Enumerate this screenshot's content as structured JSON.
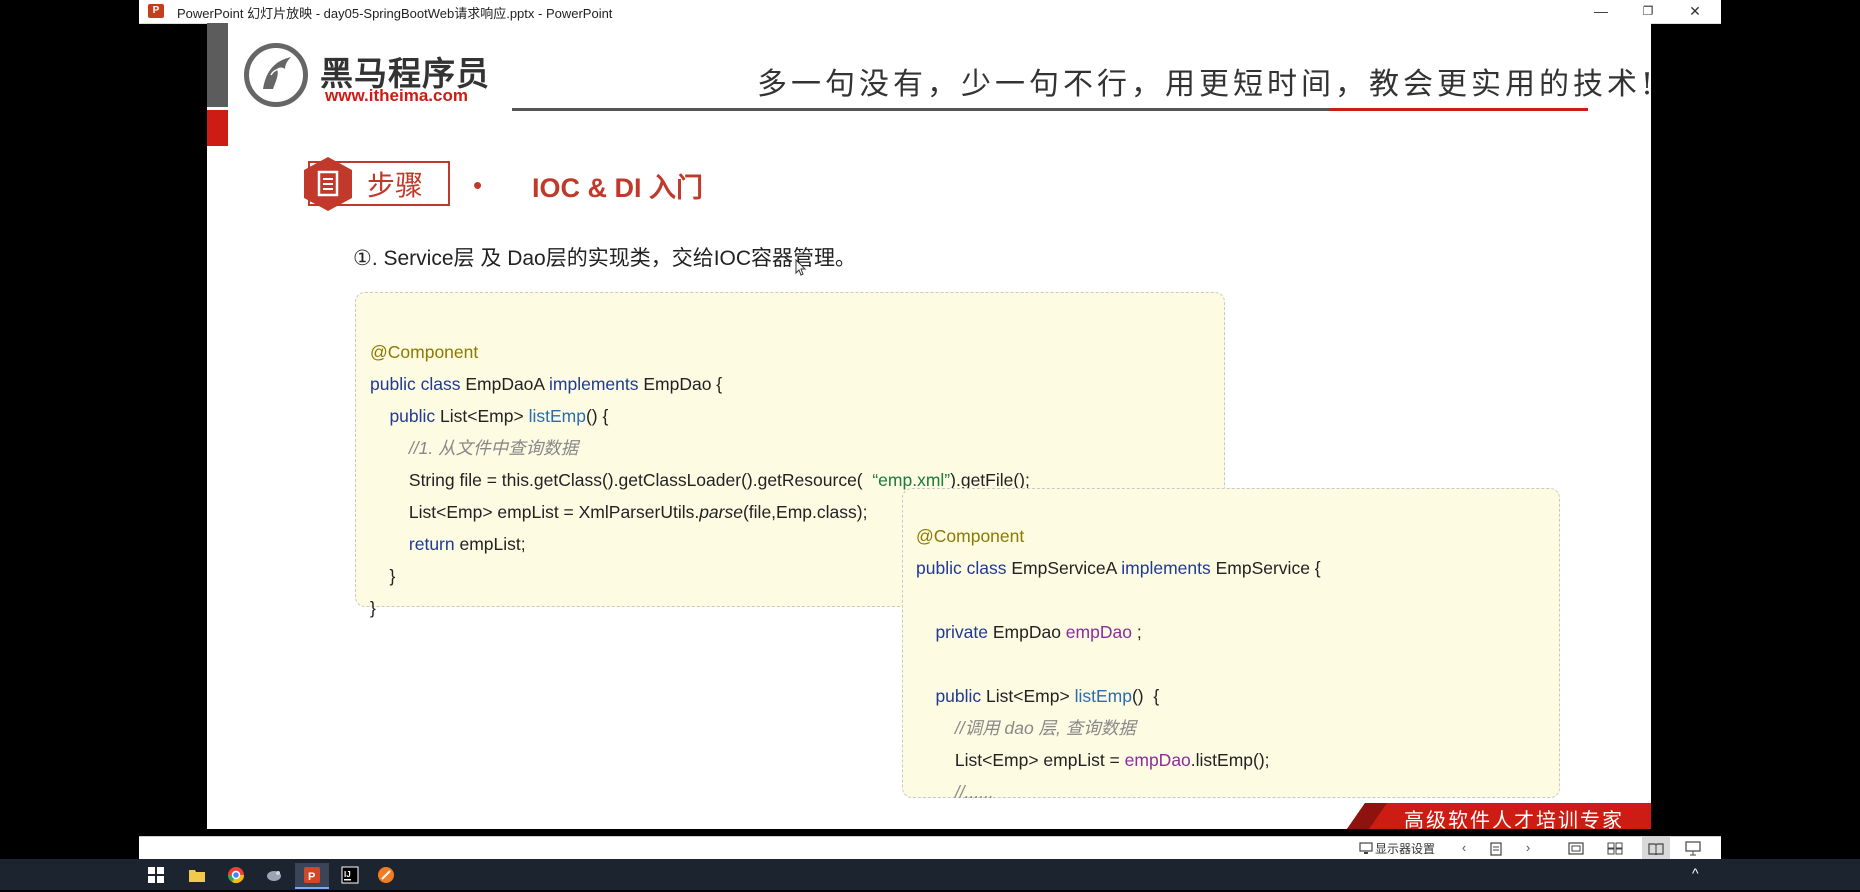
{
  "window": {
    "title": "PowerPoint 幻灯片放映  -  day05-SpringBootWeb请求响应.pptx - PowerPoint",
    "controls": {
      "minimize": "—",
      "restore": "❐",
      "close": "✕"
    }
  },
  "slide": {
    "logo": {
      "name_cn": "黑马程序员",
      "url": "www.itheima.com"
    },
    "slogan": "多一句没有，少一句不行，用更短时间，教会更实用的技术!",
    "step_label": "步骤",
    "step_bullet": "•",
    "section_title": "IOC & DI 入门",
    "step1_text": "①. Service层 及 Dao层的实现类，交给IOC容器管理。",
    "code_dao": {
      "l1": "@Component",
      "l2a": "public class",
      "l2b": " EmpDaoA ",
      "l2c": "implements",
      "l2d": " EmpDao {",
      "l3a": "    public",
      "l3b": " List<Emp> ",
      "l3c": "listEmp",
      "l3d": "() {",
      "l4": "        //1. 从文件中查询数据",
      "l5a": "        String file = this.getClass().getClassLoader().getResource(  ",
      "l5b": "“emp.xml”",
      "l5c": ").getFile();",
      "l6a": "        List<Emp> empList = XmlParserUtils.",
      "l6b": "parse",
      "l6c": "(file,Emp.class);",
      "l7a": "        return",
      "l7b": " empList;",
      "l8": "    }",
      "l9": "}"
    },
    "code_service": {
      "l1": "@Component",
      "l2a": "public class",
      "l2b": " EmpServiceA ",
      "l2c": "implements",
      "l2d": " EmpService {",
      "l4a": "    private",
      "l4b": " EmpDao ",
      "l4c": "empDao",
      "l4d": " ;",
      "l6a": "    public",
      "l6b": " List<Emp> ",
      "l6c": "listEmp",
      "l6d": "()  {",
      "l7": "        //调用 dao 层, 查询数据",
      "l8a": "        List<Emp> empList = ",
      "l8b": "empDao",
      "l8c": ".listEmp();",
      "l9": "        //......"
    },
    "footer_tag": "高级软件人才培训专家"
  },
  "statusbar": {
    "display_settings": "显示器设置"
  },
  "colors": {
    "brand_red": "#cc1c14",
    "code_bg": "#fefbe3",
    "keyword": "#1f3a93"
  }
}
